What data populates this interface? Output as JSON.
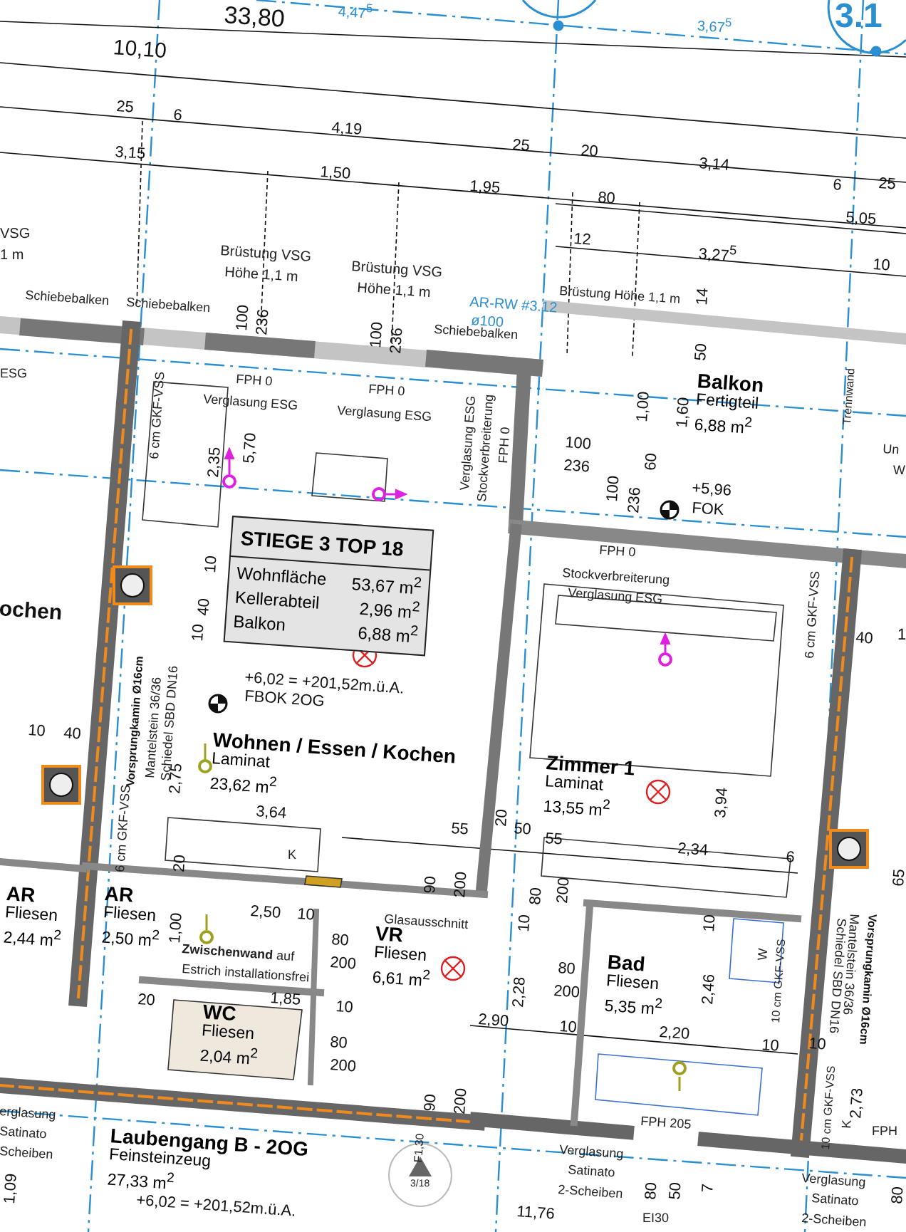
{
  "title_block": {
    "heading": "STIEGE 3  TOP 18",
    "rows": [
      {
        "label": "Wohnfläche",
        "value": "53,67 m$^{2}$"
      },
      {
        "label": "Kellerabteil",
        "value": "2,96 m$^{2}$"
      },
      {
        "label": "Balkon",
        "value": "6,88 m$^{2}$"
      }
    ]
  },
  "rooms": [
    {
      "name": "Wohnen / Essen / Kochen",
      "floor": "Laminat",
      "area": "23,62 m$^{2}$"
    },
    {
      "name": "Zimmer 1",
      "floor": "Laminat",
      "area": "13,55 m$^{2}$"
    },
    {
      "name": "Balkon",
      "floor": "Fertigteil",
      "area": "6,88 m$^{2}$"
    },
    {
      "name": "AR",
      "floor": "Fliesen",
      "area": "2,44 m$^{2}$"
    },
    {
      "name": "AR",
      "floor": "Fliesen",
      "area": "2,50 m$^{2}$"
    },
    {
      "name": "VR",
      "floor": "Fliesen",
      "area": "6,61 m$^{2}$"
    },
    {
      "name": "WC",
      "floor": "Fliesen",
      "area": "2,04 m$^{2}$"
    },
    {
      "name": "Bad",
      "floor": "Fliesen",
      "area": "5,35 m$^{2}$"
    },
    {
      "name": "Laubengang B - 2OG",
      "floor": "Feinsteinzeug",
      "area": "27,33 m$^{2}$"
    }
  ],
  "annotations": [
    {
      "text": "33,80",
      "kind": "dim"
    },
    {
      "text": "10,10",
      "kind": "dim"
    },
    {
      "text": "4,47$^{5}$",
      "kind": "blue"
    },
    {
      "text": "3,67$^{5}$",
      "kind": "blue"
    },
    {
      "text": "3.1",
      "kind": "grid"
    },
    {
      "text": "25",
      "kind": "dim"
    },
    {
      "text": "6",
      "kind": "dim"
    },
    {
      "text": "4,19",
      "kind": "dim"
    },
    {
      "text": "25",
      "kind": "dim"
    },
    {
      "text": "20",
      "kind": "dim"
    },
    {
      "text": "3,14",
      "kind": "dim"
    },
    {
      "text": "6",
      "kind": "dim"
    },
    {
      "text": "25",
      "kind": "dim"
    },
    {
      "text": "3,15",
      "kind": "dim"
    },
    {
      "text": "1,50",
      "kind": "dim"
    },
    {
      "text": "1,95",
      "kind": "dim"
    },
    {
      "text": "80",
      "kind": "dim"
    },
    {
      "text": "5,05",
      "kind": "dim"
    },
    {
      "text": "12",
      "kind": "dim"
    },
    {
      "text": "3,27$^{5}$",
      "kind": "dim"
    },
    {
      "text": "10",
      "kind": "dim"
    },
    {
      "text": "VSG",
      "kind": "note"
    },
    {
      "text": "1 m",
      "kind": "note"
    },
    {
      "text": "Brüstung VSG",
      "kind": "note"
    },
    {
      "text": "Höhe 1,1 m",
      "kind": "note"
    },
    {
      "text": "Brüstung VSG",
      "kind": "note"
    },
    {
      "text": "Höhe 1,1 m",
      "kind": "note"
    },
    {
      "text": "Schiebebalken",
      "kind": "note"
    },
    {
      "text": "Schiebebalken",
      "kind": "note"
    },
    {
      "text": "Schiebebalken",
      "kind": "note"
    },
    {
      "text": "100",
      "kind": "dim"
    },
    {
      "text": "236",
      "kind": "dim"
    },
    {
      "text": "100",
      "kind": "dim"
    },
    {
      "text": "236",
      "kind": "dim"
    },
    {
      "text": "AR-RW #3.12",
      "kind": "blue"
    },
    {
      "text": "ø100",
      "kind": "blue"
    },
    {
      "text": "Brüstung Höhe 1,1 m",
      "kind": "note"
    },
    {
      "text": "14",
      "kind": "dim"
    },
    {
      "text": "50",
      "kind": "dim"
    },
    {
      "text": "Trennwand",
      "kind": "note"
    },
    {
      "text": "ESG",
      "kind": "note"
    },
    {
      "text": "FPH 0",
      "kind": "note"
    },
    {
      "text": "Verglasung ESG",
      "kind": "note"
    },
    {
      "text": "FPH 0",
      "kind": "note"
    },
    {
      "text": "Verglasung ESG",
      "kind": "note"
    },
    {
      "text": "6 cm GKF-VSS",
      "kind": "note"
    },
    {
      "text": "2,35",
      "kind": "dim"
    },
    {
      "text": "5,70",
      "kind": "dim"
    },
    {
      "text": "Verglasung ESG",
      "kind": "note"
    },
    {
      "text": "Stockverbreiterung",
      "kind": "note"
    },
    {
      "text": "FPH 0",
      "kind": "note"
    },
    {
      "text": "100",
      "kind": "dim"
    },
    {
      "text": "236",
      "kind": "dim"
    },
    {
      "text": "1,00",
      "kind": "dim"
    },
    {
      "text": "1,60",
      "kind": "dim"
    },
    {
      "text": "60",
      "kind": "dim"
    },
    {
      "text": "100",
      "kind": "dim"
    },
    {
      "text": "236",
      "kind": "dim"
    },
    {
      "text": "+5,96",
      "kind": "dim"
    },
    {
      "text": "FOK",
      "kind": "dim"
    },
    {
      "text": "Un",
      "kind": "note"
    },
    {
      "text": "W",
      "kind": "note"
    },
    {
      "text": "FPH 0",
      "kind": "note"
    },
    {
      "text": "Stockverbreiterung",
      "kind": "note"
    },
    {
      "text": "Verglasung ESG",
      "kind": "note"
    },
    {
      "text": "6 cm GKF-VSS",
      "kind": "note"
    },
    {
      "text": "40",
      "kind": "dim"
    },
    {
      "text": "1",
      "kind": "dim"
    },
    {
      "text": "10",
      "kind": "dim"
    },
    {
      "text": "40",
      "kind": "dim"
    },
    {
      "text": "10",
      "kind": "dim"
    },
    {
      "text": "ochen",
      "kind": "bold"
    },
    {
      "text": "10",
      "kind": "dim"
    },
    {
      "text": "40",
      "kind": "dim"
    },
    {
      "text": "Vorsprungkamin Ø16cm",
      "kind": "strong"
    },
    {
      "text": "Mantelstein 36/36",
      "kind": "note"
    },
    {
      "text": "Schiedel SBD DN16",
      "kind": "note"
    },
    {
      "text": "2,75",
      "kind": "dim"
    },
    {
      "text": "3,64",
      "kind": "dim"
    },
    {
      "text": "6 cm GKF-VSS",
      "kind": "note"
    },
    {
      "text": "20",
      "kind": "dim"
    },
    {
      "text": "K",
      "kind": "note"
    },
    {
      "text": "1,00",
      "kind": "dim"
    },
    {
      "text": "2,50",
      "kind": "dim"
    },
    {
      "text": "10",
      "kind": "dim"
    },
    {
      "text": "**Zwischenwand** auf",
      "kind": "note"
    },
    {
      "text": "Estrich installationsfrei",
      "kind": "note"
    },
    {
      "text": "80",
      "kind": "dim"
    },
    {
      "text": "200",
      "kind": "dim"
    },
    {
      "text": "Glasausschnitt",
      "kind": "note"
    },
    {
      "text": "55",
      "kind": "dim"
    },
    {
      "text": "90",
      "kind": "dim"
    },
    {
      "text": "200",
      "kind": "dim"
    },
    {
      "text": "20",
      "kind": "dim"
    },
    {
      "text": "50",
      "kind": "dim"
    },
    {
      "text": "55",
      "kind": "dim"
    },
    {
      "text": "80",
      "kind": "dim"
    },
    {
      "text": "200",
      "kind": "dim"
    },
    {
      "text": "3,94",
      "kind": "dim"
    },
    {
      "text": "2,34",
      "kind": "dim"
    },
    {
      "text": "6",
      "kind": "dim"
    },
    {
      "text": "1,85",
      "kind": "dim"
    },
    {
      "text": "10",
      "kind": "dim"
    },
    {
      "text": "20",
      "kind": "dim"
    },
    {
      "text": "80",
      "kind": "dim"
    },
    {
      "text": "200",
      "kind": "dim"
    },
    {
      "text": "10",
      "kind": "dim"
    },
    {
      "text": "80",
      "kind": "dim"
    },
    {
      "text": "200",
      "kind": "dim"
    },
    {
      "text": "2,28",
      "kind": "dim"
    },
    {
      "text": "2,90",
      "kind": "dim"
    },
    {
      "text": "10",
      "kind": "dim"
    },
    {
      "text": "2,20",
      "kind": "dim"
    },
    {
      "text": "2,46",
      "kind": "dim"
    },
    {
      "text": "10",
      "kind": "dim"
    },
    {
      "text": "W",
      "kind": "note"
    },
    {
      "text": "10 cm GKF-VSS",
      "kind": "note"
    },
    {
      "text": "10",
      "kind": "dim"
    },
    {
      "text": "90",
      "kind": "dim"
    },
    {
      "text": "200",
      "kind": "dim"
    },
    {
      "text": "FPH 205",
      "kind": "note"
    },
    {
      "text": "80",
      "kind": "dim"
    },
    {
      "text": "50",
      "kind": "dim"
    },
    {
      "text": "7",
      "kind": "dim"
    },
    {
      "text": "EI30",
      "kind": "note"
    },
    {
      "text": "11,76",
      "kind": "dim"
    },
    {
      "text": "3/18",
      "kind": "note"
    },
    {
      "text": "F1,30",
      "kind": "note"
    },
    {
      "text": "Verglasung",
      "kind": "note"
    },
    {
      "text": "Satinato",
      "kind": "note"
    },
    {
      "text": "2-Scheiben",
      "kind": "note"
    },
    {
      "text": "Verglasung",
      "kind": "note"
    },
    {
      "text": "Satinato",
      "kind": "note"
    },
    {
      "text": "2-Scheiben",
      "kind": "note"
    },
    {
      "text": "erglasung",
      "kind": "note"
    },
    {
      "text": "Satinato",
      "kind": "note"
    },
    {
      "text": "Scheiben",
      "kind": "note"
    },
    {
      "text": "1,09",
      "kind": "dim"
    },
    {
      "text": "+6,02 = +201,52m.ü.A.",
      "kind": "dim"
    },
    {
      "text": "65",
      "kind": "dim"
    },
    {
      "text": "Vorsprungkamin Ø16cm",
      "kind": "strong"
    },
    {
      "text": "Mantelstein 36/36",
      "kind": "note"
    },
    {
      "text": "Schiedel SBD DN16",
      "kind": "note"
    },
    {
      "text": "10",
      "kind": "dim"
    },
    {
      "text": "2,73",
      "kind": "dim"
    },
    {
      "text": "10 cm GKF-VSS",
      "kind": "note"
    },
    {
      "text": "K",
      "kind": "note"
    },
    {
      "text": "FPH",
      "kind": "note"
    },
    {
      "text": "80",
      "kind": "dim"
    },
    {
      "text": "+6,02 = +201,52m.ü.A.",
      "kind": "dim"
    },
    {
      "text": "FBOK 2OG",
      "kind": "dim"
    }
  ]
}
